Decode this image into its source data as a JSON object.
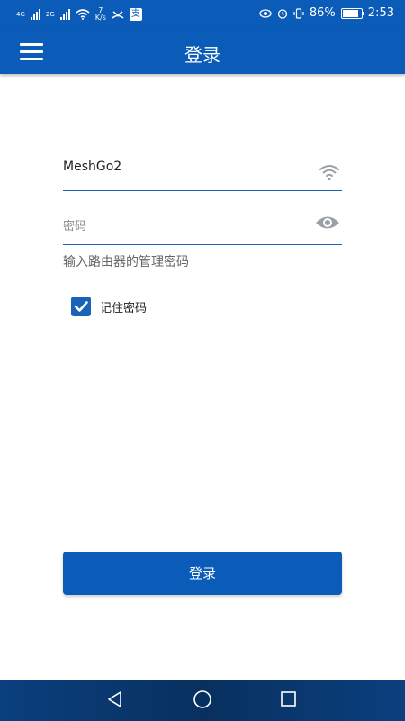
{
  "status_bar": {
    "network1": "4G",
    "network2": "2G",
    "speed_value": "7",
    "speed_unit": "K/s",
    "app_icon_glyph": "支",
    "battery_percent": "86%",
    "battery_level": 0.86,
    "time": "2:53",
    "icons": [
      "signal-icon",
      "wifi-icon",
      "speed-icon",
      "app-icon",
      "eye-comfort-icon",
      "alarm-icon",
      "vibrate-icon",
      "battery-icon"
    ]
  },
  "app_bar": {
    "title": "登录",
    "menu_icon": "hamburger-menu-icon"
  },
  "form": {
    "ssid_value": "MeshGo2",
    "ssid_icon": "wifi-icon",
    "password_placeholder": "密码",
    "password_icon": "eye-icon",
    "password_hint": "输入路由器的管理密码",
    "remember_checked": true,
    "remember_label": "记住密码",
    "login_button": "登录"
  },
  "nav_bar": {
    "icons": [
      "back-icon",
      "home-icon",
      "recents-icon"
    ]
  },
  "colors": {
    "primary": "#0a5cb8",
    "underline": "#1a63b8",
    "nav_bar": "#08305f",
    "icon_gray": "#9aa0a6"
  }
}
